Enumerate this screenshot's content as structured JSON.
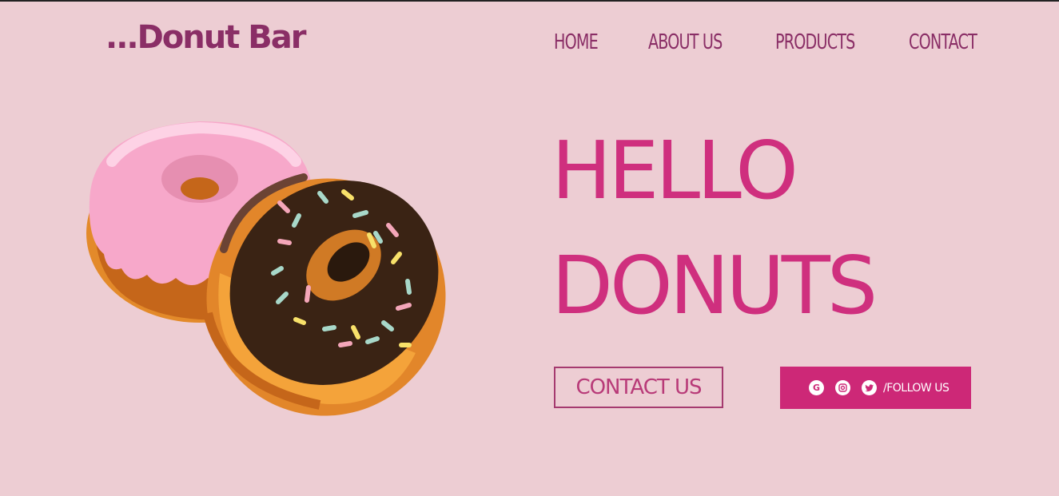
{
  "brand": {
    "logo": "...Donut Bar"
  },
  "nav": {
    "items": [
      "HOME",
      "ABOUT US",
      "PRODUCTS",
      "CONTACT"
    ]
  },
  "hero": {
    "title_line1": "HELLO",
    "title_line2": "DONUTS",
    "contact_button": "CONTACT US",
    "follow_label": "/FOLLOW US"
  },
  "social": {
    "icons": [
      "google-icon",
      "instagram-icon",
      "twitter-icon"
    ],
    "google_glyph": "G"
  },
  "colors": {
    "background": "#edcdd3",
    "accent": "#cd2877",
    "logo": "#8a2e66"
  }
}
